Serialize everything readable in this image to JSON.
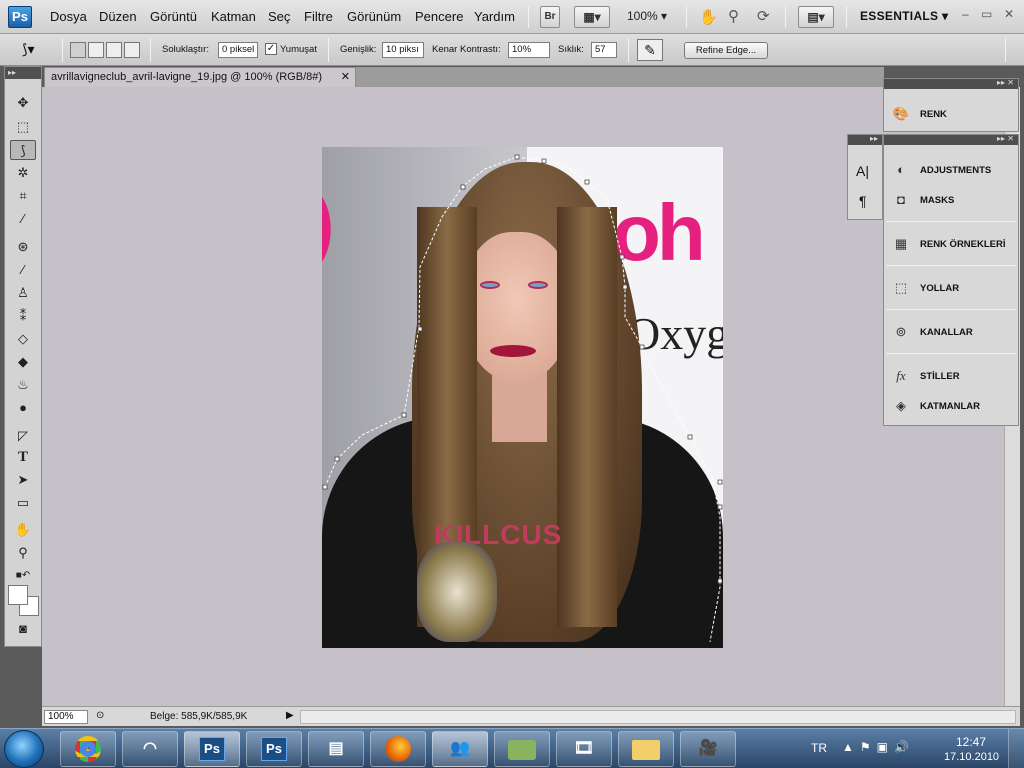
{
  "app": {
    "logo": "Ps"
  },
  "menu": [
    "Dosya",
    "Düzen",
    "Görüntü",
    "Katman",
    "Seç",
    "Filtre",
    "Görünüm",
    "Pencere",
    "Yardım"
  ],
  "menubar": {
    "bridge": "Br",
    "zoom": "100%",
    "workspace": "ESSENTIALS",
    "win_min": "–",
    "win_restore": "▭",
    "win_close": "✕"
  },
  "options": {
    "feather_label": "Soluklaştır:",
    "feather_value": "0 piksel",
    "antialias_label": "Yumuşat",
    "antialias_checked": "✓",
    "width_label": "Genişlik:",
    "width_value": "10 piksı",
    "contrast_label": "Kenar Kontrastı:",
    "contrast_value": "10%",
    "frequency_label": "Sıklık:",
    "frequency_value": "57",
    "refine_edge": "Refine Edge..."
  },
  "document": {
    "tab_title": "avrillavigneclub_avril-lavigne_19.jpg @ 100% (RGB/8#)",
    "tab_close": "✕",
    "status_zoom": "100%",
    "doc_info": "Belge: 585,9K/585,9K",
    "photo_text_1": "oh",
    "photo_text_2": "Oxyge",
    "shirt_text": "KILLCUS"
  },
  "panels": {
    "renk": "RENK",
    "items": [
      "ADJUSTMENTS",
      "MASKS",
      "RENK ÖRNEKLERİ",
      "YOLLAR",
      "KANALLAR",
      "STİLLER",
      "KATMANLAR"
    ],
    "mini_char": "A|",
    "mini_para": "¶"
  },
  "taskbar": {
    "lang": "TR",
    "time": "12:47",
    "date": "17.10.2010",
    "apps": [
      "chrome",
      "recorder",
      "photoshop",
      "photoshop",
      "notepad",
      "firefox",
      "messenger",
      "green-app",
      "media",
      "explorer",
      "camera"
    ]
  },
  "icons": {
    "ps_app": "Ps"
  }
}
